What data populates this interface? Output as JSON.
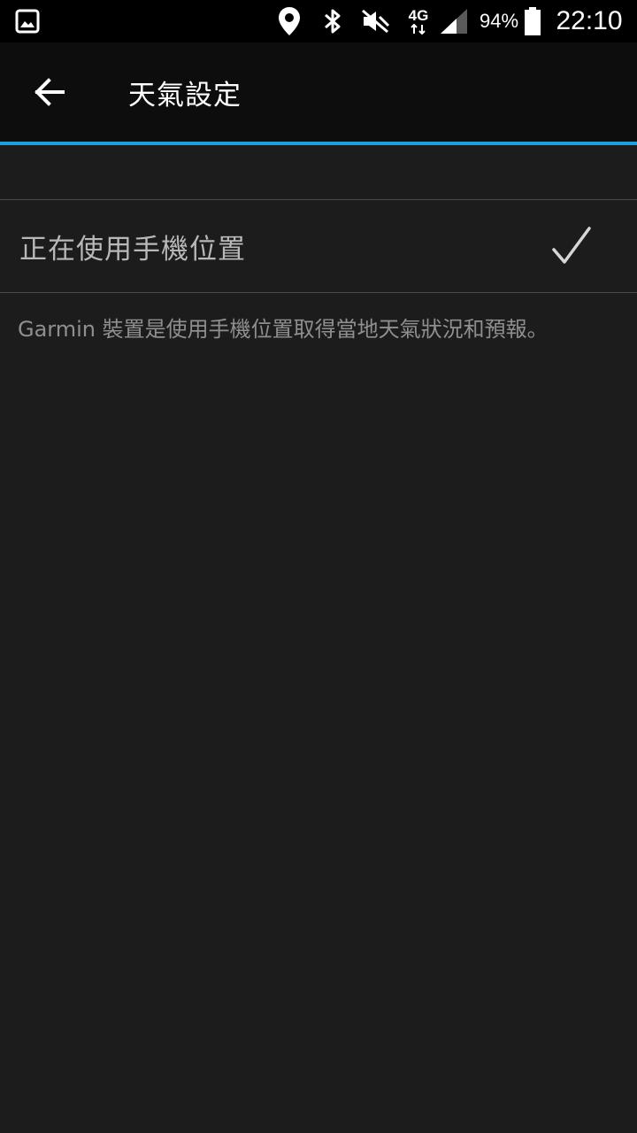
{
  "status_bar": {
    "icons": [
      "image-icon",
      "location-icon",
      "bluetooth-icon",
      "vibrate-off-icon",
      "network-4g-icon",
      "signal-icon",
      "battery-icon"
    ],
    "network_label": "4G",
    "battery_percent": "94%",
    "battery_level": 0.94,
    "time": "22:10"
  },
  "app_bar": {
    "back_icon": "arrow-left-icon",
    "title": "天氣設定"
  },
  "settings": {
    "option": {
      "label": "正在使用手機位置",
      "checked": true,
      "icon": "checkmark-icon"
    },
    "description": "Garmin 裝置是使用手機位置取得當地天氣狀況和預報。"
  },
  "colors": {
    "accent": "#1e9fe0",
    "background": "#1c1c1c",
    "app_bar": "#0d0d0d",
    "status_bar": "#000000"
  }
}
